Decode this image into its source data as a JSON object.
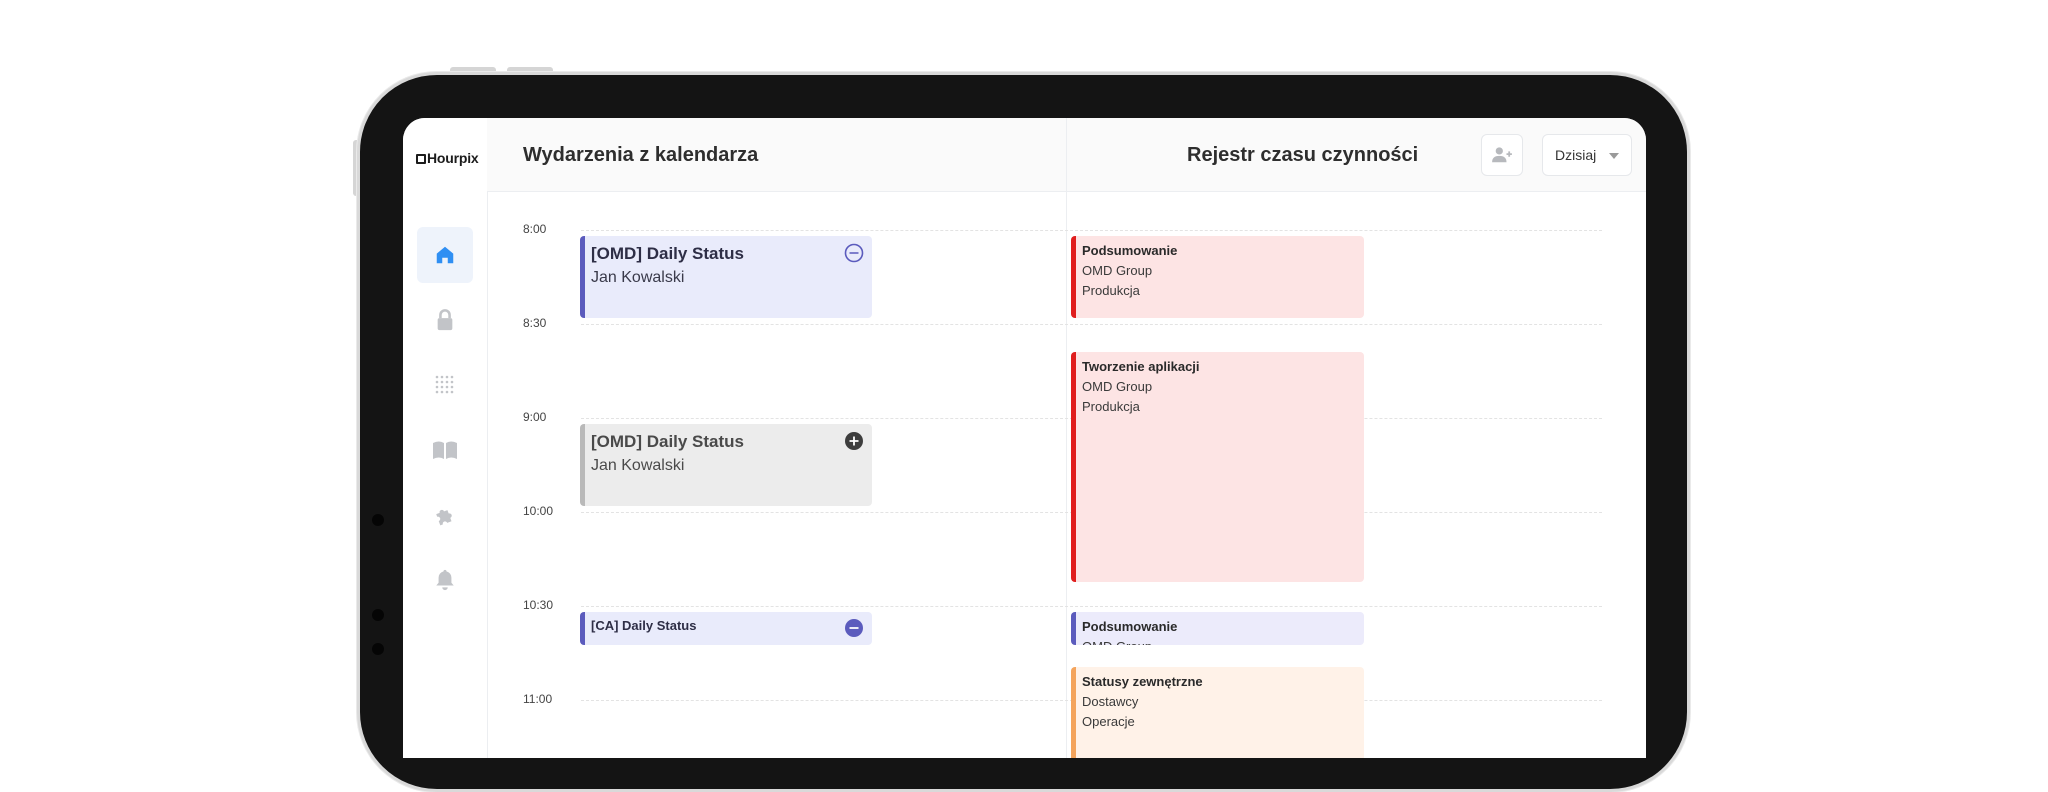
{
  "app": {
    "logo_text": "Hourpix"
  },
  "sidebar": {
    "items": [
      {
        "name": "home-icon",
        "active": true
      },
      {
        "name": "lock-icon",
        "active": false
      },
      {
        "name": "dots-grid-icon",
        "active": false
      },
      {
        "name": "book-icon",
        "active": false
      },
      {
        "name": "puzzle-icon",
        "active": false
      },
      {
        "name": "bell-icon",
        "active": false
      }
    ]
  },
  "header": {
    "calendar_title": "Wydarzenia z kalendarza",
    "log_title": "Rejestr czasu czynności",
    "date_select_value": "Dzisiaj"
  },
  "timeline": {
    "times": [
      "8:00",
      "8:30",
      "9:00",
      "10:00",
      "10:30",
      "11:00"
    ]
  },
  "calendar_events": [
    {
      "title": "[OMD] Daily Status",
      "attendee": "Jan Kowalski",
      "action": "remove"
    },
    {
      "title": "[OMD] Daily Status",
      "attendee": "Jan Kowalski",
      "action": "add"
    },
    {
      "title": "[CA] Daily Status",
      "action": "remove"
    }
  ],
  "time_log_entries": [
    {
      "title": "Podsumowanie",
      "client": "OMD Group",
      "category": "Produkcja"
    },
    {
      "title": "Tworzenie aplikacji",
      "client": "OMD Group",
      "category": "Produkcja"
    },
    {
      "title": "Podsumowanie",
      "client": "OMD Group"
    },
    {
      "title": "Statusy zewnętrzne",
      "client": "Dostawcy",
      "category": "Operacje"
    }
  ],
  "colors": {
    "accent": "#2f8ff3",
    "calendar_event_border": "#5b5bbd",
    "calendar_event_bg": "#e9ebfb",
    "inactive_event_bg": "#ececec",
    "log_red_border": "#e01e1e",
    "log_red_bg": "#fde4e4",
    "log_purple_border": "#5b5bbd",
    "log_purple_bg": "#ecebfb",
    "log_orange_border": "#f4a45c",
    "log_orange_bg": "#fff2e8"
  }
}
